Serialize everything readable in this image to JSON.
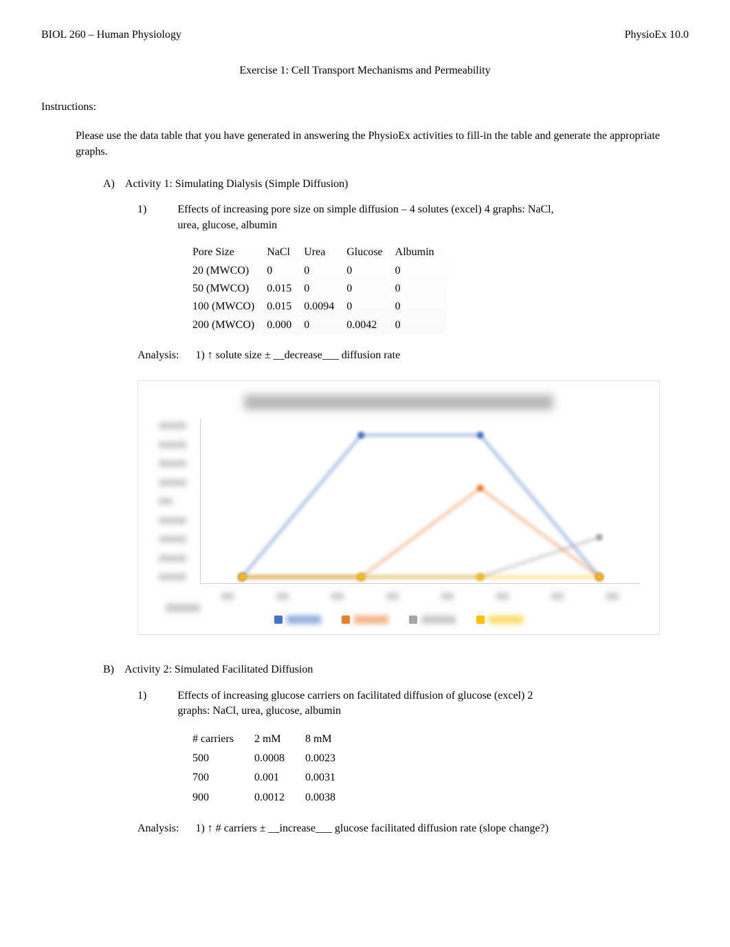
{
  "header": {
    "left": "BIOL 260 – Human Physiology",
    "right": "PhysioEx 10.0"
  },
  "title": "Exercise 1: Cell Transport Mechanisms and Permeability",
  "instructions_label": "Instructions:",
  "instructions_text": "Please use the data table that you have generated in answering the PhysioEx activities to fill-in the table and generate the appropriate graphs.",
  "sectionA": {
    "letter": "A)",
    "title": "Activity 1: Simulating Dialysis (Simple Diffusion)",
    "sub1": {
      "num": "1)",
      "text": "Effects of increasing pore size on simple diffusion – 4 solutes (excel) 4 graphs: NaCl, urea, glucose, albumin"
    },
    "table1": {
      "headers": [
        "Pore Size",
        "NaCl",
        "Urea",
        "Glucose",
        "Albumin"
      ],
      "rows": [
        [
          "20 (MWCO)",
          "0",
          "0",
          "0",
          "0"
        ],
        [
          "50 (MWCO)",
          "0.015",
          "0",
          "0",
          "0"
        ],
        [
          "100 (MWCO)",
          "0.015",
          "0.0094",
          "0",
          "0"
        ],
        [
          "200 (MWCO)",
          "0.000",
          "0",
          "0.0042",
          "0"
        ]
      ]
    },
    "analysis1": {
      "label": "Analysis:",
      "text": "1) ↑ solute size   ±  __decrease___  diffusion rate"
    }
  },
  "sectionB": {
    "letter": "B)",
    "title": "Activity 2: Simulated Facilitated Diffusion",
    "sub1": {
      "num": "1)",
      "text": "Effects of increasing glucose carriers on facilitated diffusion of glucose (excel) 2 graphs: NaCl, urea, glucose, albumin"
    },
    "table2": {
      "headers": [
        "# carriers",
        "2 mM",
        "8 mM"
      ],
      "rows": [
        [
          "500",
          "0.0008",
          "0.0023"
        ],
        [
          "700",
          "0.001",
          "0.0031"
        ],
        [
          "900",
          "0.0012",
          "0.0038"
        ]
      ]
    },
    "analysis2": {
      "label": "Analysis:",
      "text": "1) ↑ # carriers   ±  __increase___  glucose facilitated diffusion rate (slope change?)"
    }
  },
  "chart_data": {
    "type": "line",
    "title": "Simulating Dialysis (Simple Diffusion)",
    "xlabel": "",
    "ylabel": "",
    "categories": [
      20,
      50,
      100,
      200
    ],
    "series": [
      {
        "name": "NaCl",
        "color": "#4472C4",
        "values": [
          0,
          0.015,
          0.015,
          0.0
        ]
      },
      {
        "name": "Urea",
        "color": "#ED7D31",
        "values": [
          0,
          0,
          0.0094,
          0
        ]
      },
      {
        "name": "Glucose",
        "color": "#A5A5A5",
        "values": [
          0,
          0,
          0,
          0.0042
        ]
      },
      {
        "name": "Albumin",
        "color": "#FFC000",
        "values": [
          0,
          0,
          0,
          0
        ]
      }
    ],
    "ylim": [
      0,
      0.016
    ]
  }
}
